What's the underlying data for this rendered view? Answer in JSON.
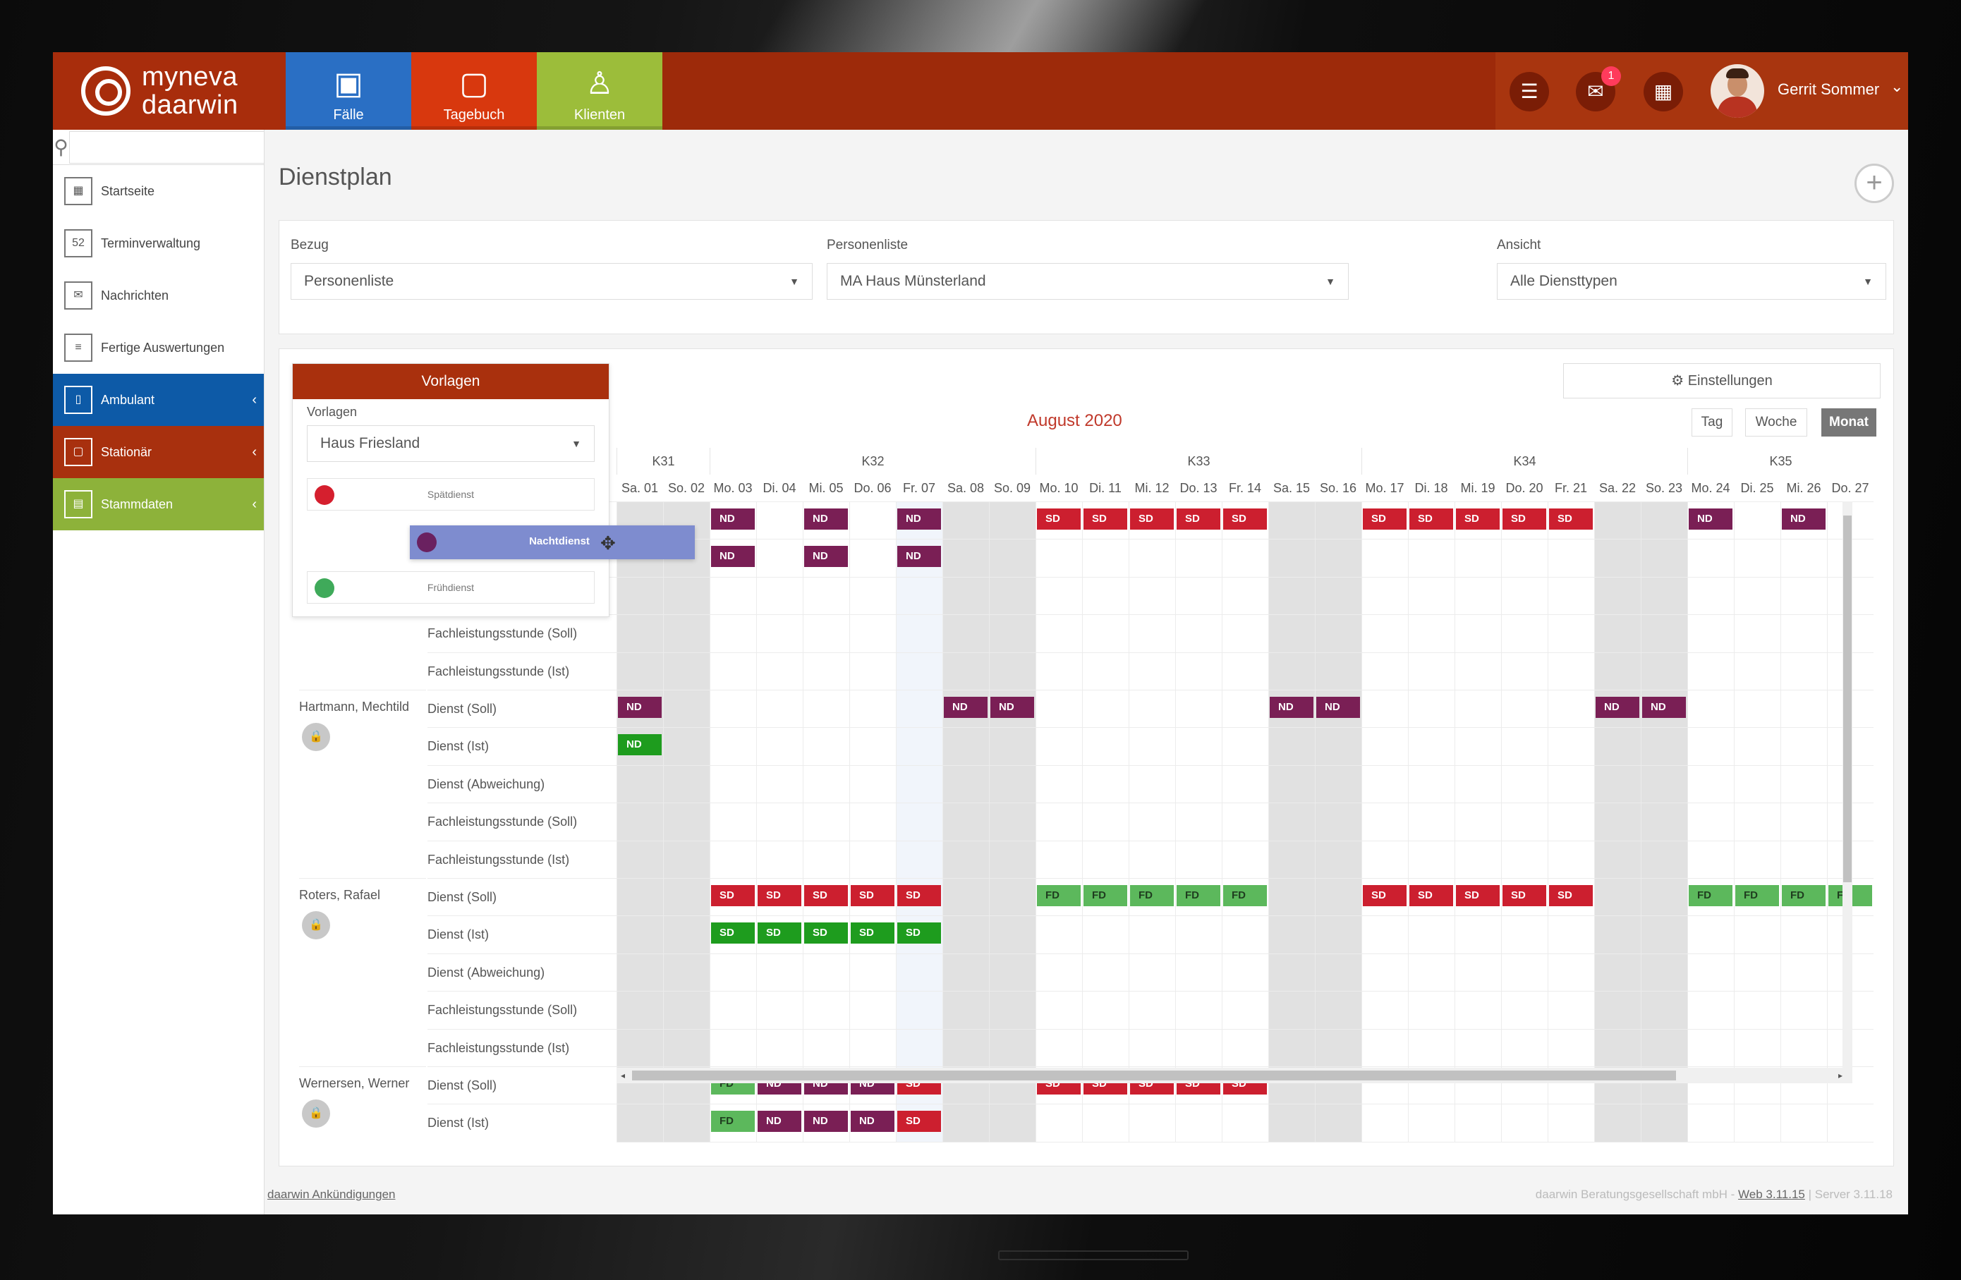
{
  "app": {
    "logo_line1": "myneva",
    "logo_line2": "daarwin"
  },
  "main_tabs": [
    {
      "label": "Fälle",
      "icon": "case-file-icon",
      "color": "#2a6fc4"
    },
    {
      "label": "Tagebuch",
      "icon": "diary-icon",
      "color": "#d8380e"
    },
    {
      "label": "Klienten",
      "icon": "client-icon",
      "color": "#9cbd3a"
    }
  ],
  "top_actions": {
    "messages_badge": "1",
    "user_name": "Gerrit Sommer"
  },
  "sidebar": {
    "search_placeholder": "",
    "items": [
      {
        "label": "Startseite",
        "icon": "home-grid-icon"
      },
      {
        "label": "Terminverwaltung",
        "icon": "calendar-icon"
      },
      {
        "label": "Nachrichten",
        "icon": "envelope-icon"
      },
      {
        "label": "Fertige Auswertungen",
        "icon": "report-icon"
      },
      {
        "label": "Ambulant",
        "icon": "clipboard-icon",
        "color": "#0d5aa7"
      },
      {
        "label": "Stationär",
        "icon": "note-icon",
        "color": "#a8300e"
      },
      {
        "label": "Stammdaten",
        "icon": "id-card-icon",
        "color": "#8db23a"
      }
    ]
  },
  "page": {
    "title": "Dienstplan"
  },
  "filters": {
    "bezug_label": "Bezug",
    "bezug_value": "Personenliste",
    "personenliste_label": "Personenliste",
    "personenliste_value": "MA Haus Münsterland",
    "ansicht_label": "Ansicht",
    "ansicht_value": "Alle Diensttypen"
  },
  "vorlagen": {
    "header": "Vorlagen",
    "label": "Vorlagen",
    "selected": "Haus Friesland",
    "templates": [
      {
        "name": "Spätdienst",
        "color": "#d51f2e"
      },
      {
        "name": "Nachtdienst",
        "color": "#6a2160"
      },
      {
        "name": "Frühdienst",
        "color": "#3faa5a"
      }
    ]
  },
  "calendar": {
    "settings_label": "Einstellungen",
    "month_title": "August 2020",
    "view_buttons": [
      "Tag",
      "Woche",
      "Monat"
    ],
    "active_view": "Monat",
    "weeks": [
      "K31",
      "K32",
      "K33",
      "K34",
      "K35"
    ],
    "days": [
      "Sa. 01",
      "So. 02",
      "Mo. 03",
      "Di. 04",
      "Mi. 05",
      "Do. 06",
      "Fr. 07",
      "Sa. 08",
      "So. 09",
      "Mo. 10",
      "Di. 11",
      "Mi. 12",
      "Do. 13",
      "Fr. 14",
      "Sa. 15",
      "So. 16",
      "Mo. 17",
      "Di. 18",
      "Mi. 19",
      "Do. 20",
      "Fr. 21",
      "Sa. 22",
      "So. 23",
      "Mo. 24",
      "Di. 25",
      "Mi. 26",
      "Do. 27"
    ],
    "persons": [
      {
        "name": "",
        "rows": [
          "",
          "",
          "",
          "Fachleistungsstunde (Soll)",
          "Fachleistungsstunde (Ist)"
        ]
      },
      {
        "name": "Hartmann, Mechtild",
        "rows": [
          "Dienst (Soll)",
          "Dienst (Ist)",
          "Dienst (Abweichung)",
          "Fachleistungsstunde (Soll)",
          "Fachleistungsstunde (Ist)"
        ]
      },
      {
        "name": "Roters, Rafael",
        "rows": [
          "Dienst (Soll)",
          "Dienst (Ist)",
          "Dienst (Abweichung)",
          "Fachleistungsstunde (Soll)",
          "Fachleistungsstunde (Ist)"
        ]
      },
      {
        "name": "Wernersen, Werner",
        "rows": [
          "Dienst (Soll)",
          "Dienst (Ist)"
        ]
      }
    ],
    "shifts": [
      {
        "row": 0,
        "day": 2,
        "code": "ND"
      },
      {
        "row": 0,
        "day": 4,
        "code": "ND"
      },
      {
        "row": 0,
        "day": 6,
        "code": "ND"
      },
      {
        "row": 0,
        "day": 9,
        "code": "SD"
      },
      {
        "row": 0,
        "day": 10,
        "code": "SD"
      },
      {
        "row": 0,
        "day": 11,
        "code": "SD"
      },
      {
        "row": 0,
        "day": 12,
        "code": "SD"
      },
      {
        "row": 0,
        "day": 13,
        "code": "SD"
      },
      {
        "row": 0,
        "day": 16,
        "code": "SD"
      },
      {
        "row": 0,
        "day": 17,
        "code": "SD"
      },
      {
        "row": 0,
        "day": 18,
        "code": "SD"
      },
      {
        "row": 0,
        "day": 19,
        "code": "SD"
      },
      {
        "row": 0,
        "day": 20,
        "code": "SD"
      },
      {
        "row": 0,
        "day": 23,
        "code": "ND"
      },
      {
        "row": 0,
        "day": 25,
        "code": "ND"
      },
      {
        "row": 1,
        "day": 2,
        "code": "ND"
      },
      {
        "row": 1,
        "day": 4,
        "code": "ND"
      },
      {
        "row": 1,
        "day": 6,
        "code": "ND"
      },
      {
        "row": 5,
        "day": 0,
        "code": "ND"
      },
      {
        "row": 5,
        "day": 7,
        "code": "ND"
      },
      {
        "row": 5,
        "day": 8,
        "code": "ND"
      },
      {
        "row": 5,
        "day": 14,
        "code": "ND"
      },
      {
        "row": 5,
        "day": 15,
        "code": "ND"
      },
      {
        "row": 5,
        "day": 21,
        "code": "ND"
      },
      {
        "row": 5,
        "day": 22,
        "code": "ND"
      },
      {
        "row": 6,
        "day": 0,
        "code": "ND",
        "variant": "FDd"
      },
      {
        "row": 10,
        "day": 2,
        "code": "SD"
      },
      {
        "row": 10,
        "day": 3,
        "code": "SD"
      },
      {
        "row": 10,
        "day": 4,
        "code": "SD"
      },
      {
        "row": 10,
        "day": 5,
        "code": "SD"
      },
      {
        "row": 10,
        "day": 6,
        "code": "SD"
      },
      {
        "row": 10,
        "day": 9,
        "code": "FD"
      },
      {
        "row": 10,
        "day": 10,
        "code": "FD"
      },
      {
        "row": 10,
        "day": 11,
        "code": "FD"
      },
      {
        "row": 10,
        "day": 12,
        "code": "FD"
      },
      {
        "row": 10,
        "day": 13,
        "code": "FD"
      },
      {
        "row": 10,
        "day": 16,
        "code": "SD"
      },
      {
        "row": 10,
        "day": 17,
        "code": "SD"
      },
      {
        "row": 10,
        "day": 18,
        "code": "SD"
      },
      {
        "row": 10,
        "day": 19,
        "code": "SD"
      },
      {
        "row": 10,
        "day": 20,
        "code": "SD"
      },
      {
        "row": 10,
        "day": 23,
        "code": "FD"
      },
      {
        "row": 10,
        "day": 24,
        "code": "FD"
      },
      {
        "row": 10,
        "day": 25,
        "code": "FD"
      },
      {
        "row": 10,
        "day": 26,
        "code": "FD"
      },
      {
        "row": 11,
        "day": 2,
        "code": "SD",
        "variant": "FDd"
      },
      {
        "row": 11,
        "day": 3,
        "code": "SD",
        "variant": "FDd"
      },
      {
        "row": 11,
        "day": 4,
        "code": "SD",
        "variant": "FDd"
      },
      {
        "row": 11,
        "day": 5,
        "code": "SD",
        "variant": "FDd"
      },
      {
        "row": 11,
        "day": 6,
        "code": "SD",
        "variant": "FDd"
      },
      {
        "row": 15,
        "day": 2,
        "code": "FD"
      },
      {
        "row": 15,
        "day": 3,
        "code": "ND"
      },
      {
        "row": 15,
        "day": 4,
        "code": "ND"
      },
      {
        "row": 15,
        "day": 5,
        "code": "ND"
      },
      {
        "row": 15,
        "day": 6,
        "code": "SD"
      },
      {
        "row": 15,
        "day": 9,
        "code": "SD"
      },
      {
        "row": 15,
        "day": 10,
        "code": "SD"
      },
      {
        "row": 15,
        "day": 11,
        "code": "SD"
      },
      {
        "row": 15,
        "day": 12,
        "code": "SD"
      },
      {
        "row": 15,
        "day": 13,
        "code": "SD"
      },
      {
        "row": 16,
        "day": 2,
        "code": "FD"
      },
      {
        "row": 16,
        "day": 3,
        "code": "ND"
      },
      {
        "row": 16,
        "day": 4,
        "code": "ND"
      },
      {
        "row": 16,
        "day": 5,
        "code": "ND"
      },
      {
        "row": 16,
        "day": 6,
        "code": "SD"
      }
    ]
  },
  "footer": {
    "left_link": "daarwin Ankündigungen",
    "company": "daarwin Beratungsgesellschaft mbH - ",
    "web_version": "Web 3.11.15",
    "server_version": " | Server 3.11.18"
  }
}
